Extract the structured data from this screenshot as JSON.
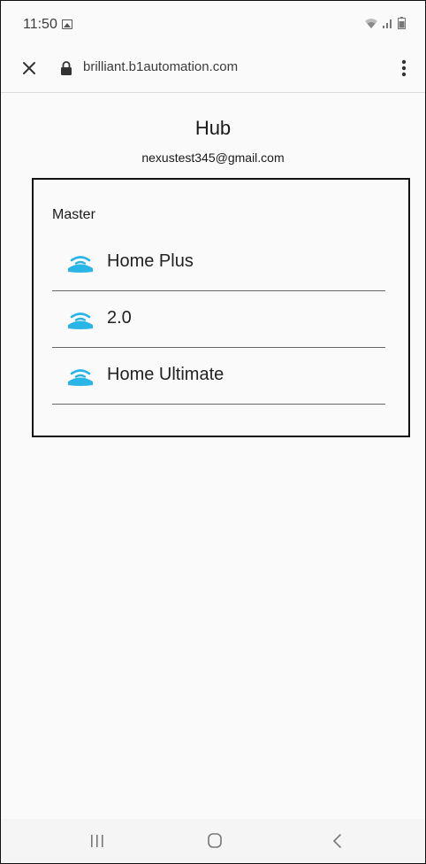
{
  "status_bar": {
    "time": "11:50",
    "notification_icon": "gallery-icon",
    "icons": [
      "wifi-icon",
      "signal-icon",
      "battery-icon"
    ]
  },
  "browser": {
    "url": "brilliant.b1automation.com",
    "close_icon": "close-icon",
    "lock_icon": "lock-icon",
    "menu_icon": "more-vert-icon"
  },
  "page": {
    "title": "Hub",
    "email": "nexustest345@gmail.com"
  },
  "hub_list": {
    "section_label": "Master",
    "items": [
      {
        "label": "Home Plus",
        "icon": "router-icon"
      },
      {
        "label": "2.0",
        "icon": "router-icon"
      },
      {
        "label": "Home Ultimate",
        "icon": "router-icon"
      }
    ]
  },
  "nav_bar": {
    "buttons": [
      "recent-apps-icon",
      "home-icon",
      "back-icon"
    ]
  },
  "colors": {
    "accent": "#29b6e6",
    "background": "#fafafa",
    "text": "#1a1a1a"
  }
}
